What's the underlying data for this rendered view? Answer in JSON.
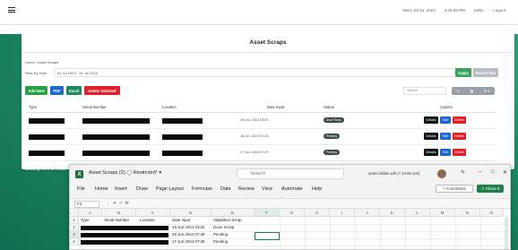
{
  "topbar": {
    "menu_icon": "hamburger-icon",
    "right_items": [
      "Wed, Jul 24, 2024",
      "4:25:58 PM",
      "Hello,",
      "Logout"
    ]
  },
  "panel": {
    "title": "Asset Scraps",
    "breadcrumb": "Home  /  Asset Scraps",
    "filter_label": "Filter By Date",
    "filter_value": "01 Jul 2024 - 31 Jul 2024",
    "apply_label": "Apply",
    "reset_label": "Reset Filter",
    "buttons": {
      "add": "Add New",
      "pdf": "PDF",
      "excel": "Excel",
      "delete_selected": "Delete Selected"
    },
    "search_placeholder": "Search",
    "tools": [
      "↻",
      "▦",
      "☰ ▾"
    ],
    "columns": [
      "Type",
      "Serial Number",
      "Location",
      "Date Input",
      "Status",
      "Actions"
    ],
    "rows": [
      {
        "date": "25 Jun 2024 23:02",
        "status": "Done Scrap"
      },
      {
        "date": "26 Jun 2024 07:28",
        "status": "Pending"
      },
      {
        "date": "17 Jun 2024 07:29",
        "status": "Pending"
      }
    ],
    "action_labels": {
      "details": "Details",
      "edit": "Edit",
      "delete": "Delete"
    },
    "showing": "Showing 1 to 3 of 3 rows"
  },
  "excel": {
    "filename": "Asset Scraps (2)",
    "label": "Restricted*",
    "search": "Search",
    "user": "andrei.billiks.adh (7.19.99.100)",
    "menu": [
      "File",
      "Home",
      "Insert",
      "Draw",
      "Page Layout",
      "Formulas",
      "Data",
      "Review",
      "View",
      "Automate",
      "Help"
    ],
    "comments": "Comments",
    "share": "Share",
    "name_box": "F3",
    "fx": "fx",
    "col_headers": [
      "A",
      "B",
      "C",
      "D",
      "E",
      "F",
      "G",
      "H",
      "I",
      "J",
      "K",
      "L",
      "M",
      "N",
      "O"
    ],
    "row_headers": [
      "1",
      "2",
      "3",
      "4"
    ],
    "header_row": [
      "Type",
      "Serial Number",
      "Location",
      "Date Input",
      "Validation Scrap"
    ],
    "data_rows": [
      {
        "date": "25 Jun 2024 23:02",
        "status": "Done Scrap"
      },
      {
        "date": "26 Jun 2024 07:28",
        "status": "Pending"
      },
      {
        "date": "17 Jun 2024 07:29",
        "status": "Pending"
      }
    ]
  },
  "colors": {
    "accent_green": "#1f8b66",
    "excel_green": "#1d7f49",
    "danger": "#e0212b",
    "primary": "#1e67d3"
  }
}
